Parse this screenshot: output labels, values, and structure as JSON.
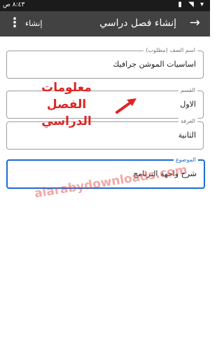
{
  "status_bar": {
    "time": "٨:٤٣ ص",
    "icons": "▮ ◥ ▾"
  },
  "app_bar": {
    "title": "إنشاء فصل دراسي",
    "back_icon": "→",
    "create_label": "إنشاء",
    "menu_icon": "⋮"
  },
  "fields": [
    {
      "label": "اسم الصف (مطلوب)",
      "value": "اساسيات الموشن جرافيك"
    },
    {
      "label": "القسم",
      "value": "الاول"
    },
    {
      "label": "الغرفة",
      "value": "الثانية"
    },
    {
      "label": "الموضوع",
      "value": "شرح واجهة البرنامج"
    }
  ],
  "overlay": {
    "line1": "معلومات",
    "line2": "الفصل الدراسي"
  },
  "watermark": "alarabydownloads.com",
  "colors": {
    "accent": "#1e6ad6",
    "overlay_red": "#e02424",
    "app_bar": "#424242"
  }
}
